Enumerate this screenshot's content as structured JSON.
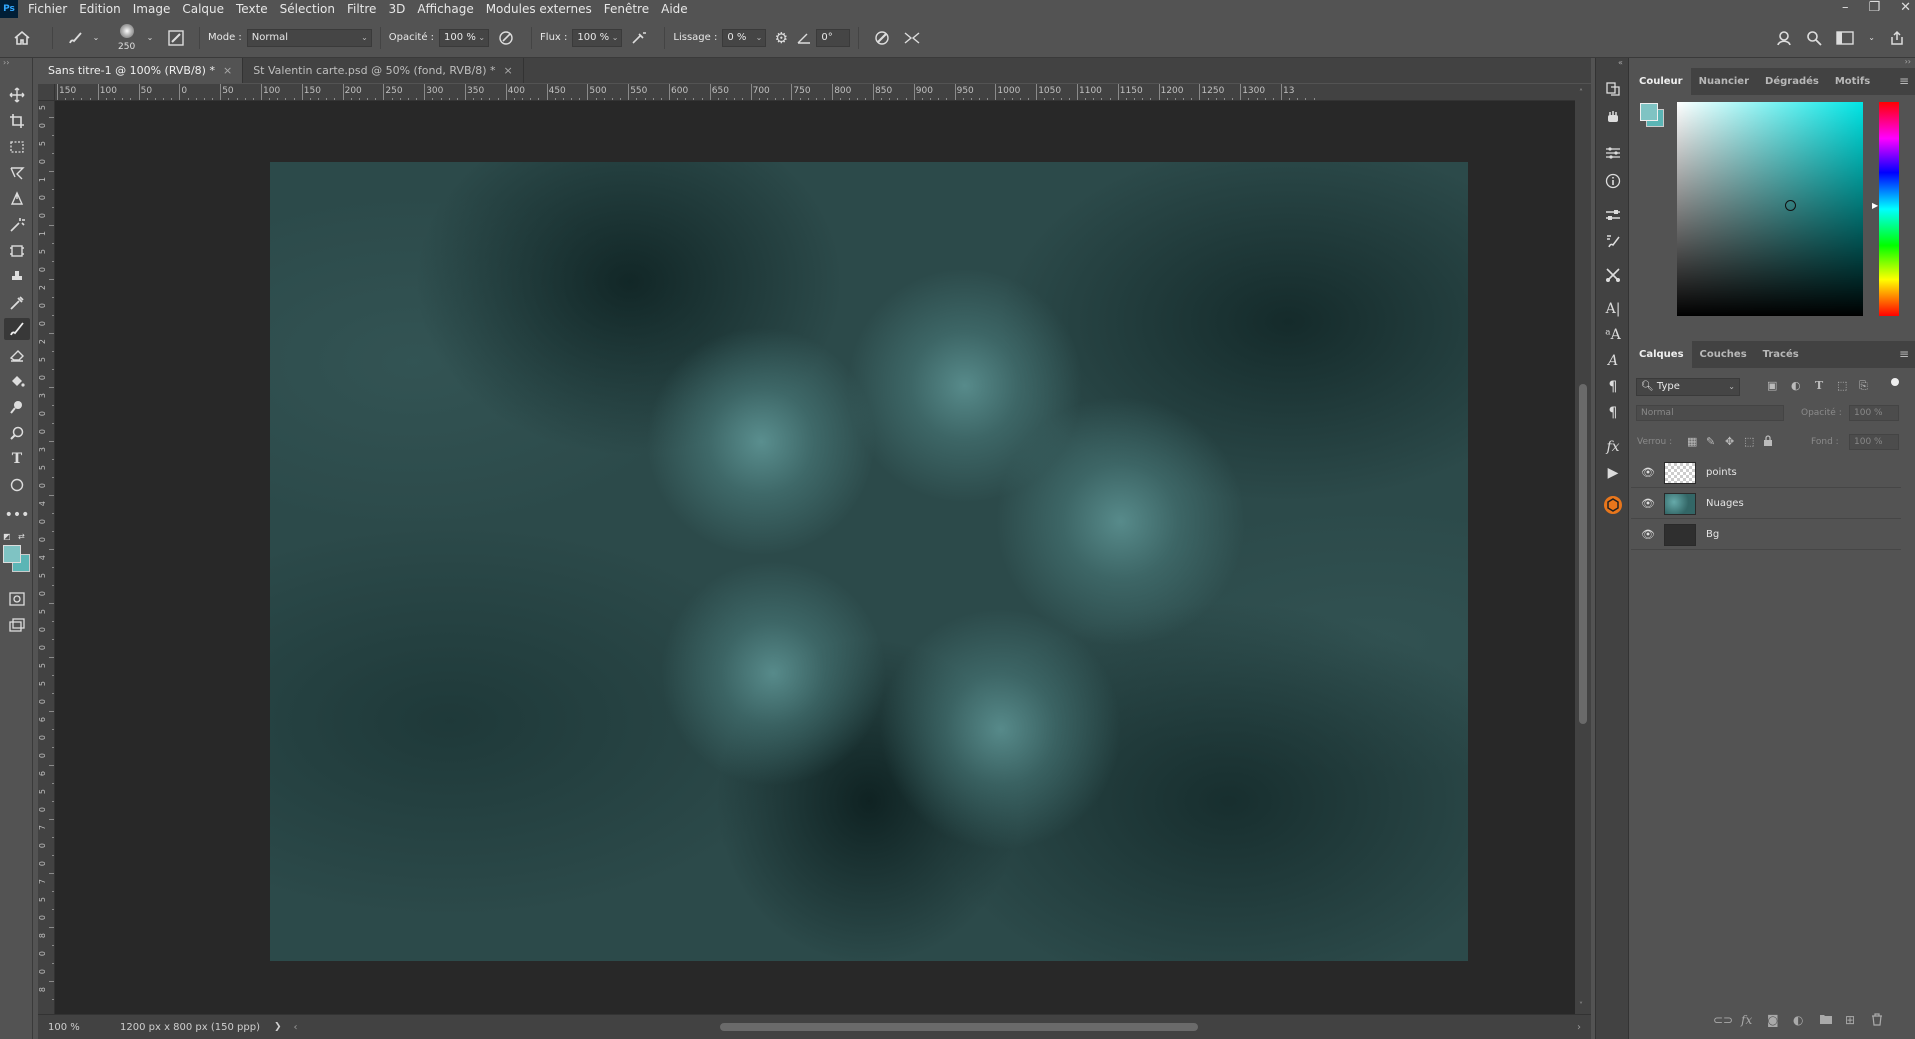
{
  "app": {
    "logo": "Ps"
  },
  "menu": [
    "Fichier",
    "Edition",
    "Image",
    "Calque",
    "Texte",
    "Sélection",
    "Filtre",
    "3D",
    "Affichage",
    "Modules externes",
    "Fenêtre",
    "Aide"
  ],
  "window_controls": [
    "–",
    "❐",
    "✕"
  ],
  "options": {
    "brush_size": "250",
    "mode_label": "Mode :",
    "mode_value": "Normal",
    "opacity_label": "Opacité :",
    "opacity_value": "100 %",
    "flux_label": "Flux :",
    "flux_value": "100 %",
    "lissage_label": "Lissage :",
    "lissage_value": "0 %",
    "angle_value": "0°"
  },
  "tabs": [
    {
      "label": "Sans titre-1 @ 100% (RVB/8) *",
      "active": true
    },
    {
      "label": "St Valentin carte.psd @ 50% (fond, RVB/8) *",
      "active": false
    }
  ],
  "ruler": {
    "h_labels": [
      "150",
      "100",
      "50",
      "0",
      "50",
      "100",
      "150",
      "200",
      "250",
      "300",
      "350",
      "400",
      "450",
      "500",
      "550",
      "600",
      "650",
      "700",
      "750",
      "800",
      "850",
      "900",
      "950",
      "1000",
      "1050",
      "1100",
      "1150",
      "1200",
      "1250",
      "1300",
      "13"
    ],
    "v_labels": [
      "5",
      "0",
      "5",
      "0",
      "1",
      "0",
      "0",
      "1",
      "5",
      "0",
      "2",
      "0",
      "0",
      "2",
      "5",
      "0",
      "3",
      "0",
      "0",
      "3",
      "5",
      "0",
      "4",
      "0",
      "0",
      "4",
      "5",
      "0",
      "5",
      "0",
      "0",
      "5",
      "5",
      "0",
      "6",
      "0",
      "0",
      "6",
      "5",
      "0",
      "7",
      "0",
      "0",
      "7",
      "5",
      "0",
      "8",
      "0",
      "0",
      "8"
    ]
  },
  "status": {
    "zoom": "100 %",
    "doc_info": "1200 px x 800 px (150 ppp)",
    "arrow": "❯"
  },
  "color_panel": {
    "tabs": [
      "Couleur",
      "Nuancier",
      "Dégradés",
      "Motifs"
    ],
    "foreground": "#7fc3c3",
    "background": "#5bb5b5"
  },
  "layers_panel": {
    "tabs": [
      "Calques",
      "Couches",
      "Tracés"
    ],
    "filter_label": "Type",
    "blend_mode": "Normal",
    "opacity_label": "Opacité :",
    "opacity_value": "100 %",
    "lock_label": "Verrou :",
    "fill_label": "Fond :",
    "fill_value": "100 %",
    "layers": [
      {
        "name": "points",
        "thumb": "transparent"
      },
      {
        "name": "Nuages",
        "thumb": "clouds"
      },
      {
        "name": "Bg",
        "thumb": "dark"
      }
    ]
  }
}
